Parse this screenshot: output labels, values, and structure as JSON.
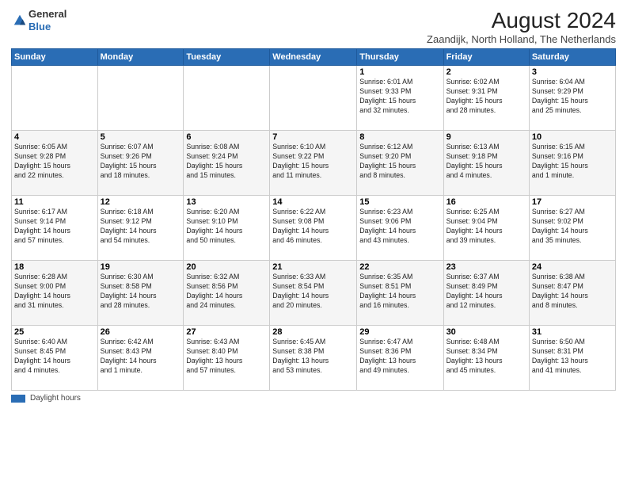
{
  "logo": {
    "line1": "General",
    "line2": "Blue"
  },
  "title": "August 2024",
  "subtitle": "Zaandijk, North Holland, The Netherlands",
  "days_header": [
    "Sunday",
    "Monday",
    "Tuesday",
    "Wednesday",
    "Thursday",
    "Friday",
    "Saturday"
  ],
  "footer_label": "Daylight hours",
  "weeks": [
    [
      {
        "num": "",
        "info": ""
      },
      {
        "num": "",
        "info": ""
      },
      {
        "num": "",
        "info": ""
      },
      {
        "num": "",
        "info": ""
      },
      {
        "num": "1",
        "info": "Sunrise: 6:01 AM\nSunset: 9:33 PM\nDaylight: 15 hours\nand 32 minutes."
      },
      {
        "num": "2",
        "info": "Sunrise: 6:02 AM\nSunset: 9:31 PM\nDaylight: 15 hours\nand 28 minutes."
      },
      {
        "num": "3",
        "info": "Sunrise: 6:04 AM\nSunset: 9:29 PM\nDaylight: 15 hours\nand 25 minutes."
      }
    ],
    [
      {
        "num": "4",
        "info": "Sunrise: 6:05 AM\nSunset: 9:28 PM\nDaylight: 15 hours\nand 22 minutes."
      },
      {
        "num": "5",
        "info": "Sunrise: 6:07 AM\nSunset: 9:26 PM\nDaylight: 15 hours\nand 18 minutes."
      },
      {
        "num": "6",
        "info": "Sunrise: 6:08 AM\nSunset: 9:24 PM\nDaylight: 15 hours\nand 15 minutes."
      },
      {
        "num": "7",
        "info": "Sunrise: 6:10 AM\nSunset: 9:22 PM\nDaylight: 15 hours\nand 11 minutes."
      },
      {
        "num": "8",
        "info": "Sunrise: 6:12 AM\nSunset: 9:20 PM\nDaylight: 15 hours\nand 8 minutes."
      },
      {
        "num": "9",
        "info": "Sunrise: 6:13 AM\nSunset: 9:18 PM\nDaylight: 15 hours\nand 4 minutes."
      },
      {
        "num": "10",
        "info": "Sunrise: 6:15 AM\nSunset: 9:16 PM\nDaylight: 15 hours\nand 1 minute."
      }
    ],
    [
      {
        "num": "11",
        "info": "Sunrise: 6:17 AM\nSunset: 9:14 PM\nDaylight: 14 hours\nand 57 minutes."
      },
      {
        "num": "12",
        "info": "Sunrise: 6:18 AM\nSunset: 9:12 PM\nDaylight: 14 hours\nand 54 minutes."
      },
      {
        "num": "13",
        "info": "Sunrise: 6:20 AM\nSunset: 9:10 PM\nDaylight: 14 hours\nand 50 minutes."
      },
      {
        "num": "14",
        "info": "Sunrise: 6:22 AM\nSunset: 9:08 PM\nDaylight: 14 hours\nand 46 minutes."
      },
      {
        "num": "15",
        "info": "Sunrise: 6:23 AM\nSunset: 9:06 PM\nDaylight: 14 hours\nand 43 minutes."
      },
      {
        "num": "16",
        "info": "Sunrise: 6:25 AM\nSunset: 9:04 PM\nDaylight: 14 hours\nand 39 minutes."
      },
      {
        "num": "17",
        "info": "Sunrise: 6:27 AM\nSunset: 9:02 PM\nDaylight: 14 hours\nand 35 minutes."
      }
    ],
    [
      {
        "num": "18",
        "info": "Sunrise: 6:28 AM\nSunset: 9:00 PM\nDaylight: 14 hours\nand 31 minutes."
      },
      {
        "num": "19",
        "info": "Sunrise: 6:30 AM\nSunset: 8:58 PM\nDaylight: 14 hours\nand 28 minutes."
      },
      {
        "num": "20",
        "info": "Sunrise: 6:32 AM\nSunset: 8:56 PM\nDaylight: 14 hours\nand 24 minutes."
      },
      {
        "num": "21",
        "info": "Sunrise: 6:33 AM\nSunset: 8:54 PM\nDaylight: 14 hours\nand 20 minutes."
      },
      {
        "num": "22",
        "info": "Sunrise: 6:35 AM\nSunset: 8:51 PM\nDaylight: 14 hours\nand 16 minutes."
      },
      {
        "num": "23",
        "info": "Sunrise: 6:37 AM\nSunset: 8:49 PM\nDaylight: 14 hours\nand 12 minutes."
      },
      {
        "num": "24",
        "info": "Sunrise: 6:38 AM\nSunset: 8:47 PM\nDaylight: 14 hours\nand 8 minutes."
      }
    ],
    [
      {
        "num": "25",
        "info": "Sunrise: 6:40 AM\nSunset: 8:45 PM\nDaylight: 14 hours\nand 4 minutes."
      },
      {
        "num": "26",
        "info": "Sunrise: 6:42 AM\nSunset: 8:43 PM\nDaylight: 14 hours\nand 1 minute."
      },
      {
        "num": "27",
        "info": "Sunrise: 6:43 AM\nSunset: 8:40 PM\nDaylight: 13 hours\nand 57 minutes."
      },
      {
        "num": "28",
        "info": "Sunrise: 6:45 AM\nSunset: 8:38 PM\nDaylight: 13 hours\nand 53 minutes."
      },
      {
        "num": "29",
        "info": "Sunrise: 6:47 AM\nSunset: 8:36 PM\nDaylight: 13 hours\nand 49 minutes."
      },
      {
        "num": "30",
        "info": "Sunrise: 6:48 AM\nSunset: 8:34 PM\nDaylight: 13 hours\nand 45 minutes."
      },
      {
        "num": "31",
        "info": "Sunrise: 6:50 AM\nSunset: 8:31 PM\nDaylight: 13 hours\nand 41 minutes."
      }
    ]
  ]
}
